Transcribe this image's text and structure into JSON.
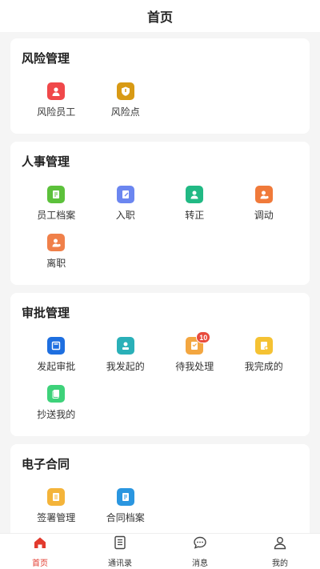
{
  "header": {
    "title": "首页"
  },
  "colors": {
    "accent": "#e23a2e",
    "badge": "#e84a3c"
  },
  "sections": [
    {
      "title": "风险管理",
      "items": [
        {
          "label": "风险员工",
          "icon": "risk-employee-icon",
          "color": "#f0484a"
        },
        {
          "label": "风险点",
          "icon": "risk-point-icon",
          "color": "#d89a14"
        }
      ]
    },
    {
      "title": "人事管理",
      "items": [
        {
          "label": "员工档案",
          "icon": "employee-file-icon",
          "color": "#5cc13b"
        },
        {
          "label": "入职",
          "icon": "onboarding-icon",
          "color": "#6b86f0"
        },
        {
          "label": "转正",
          "icon": "regularization-icon",
          "color": "#21b984"
        },
        {
          "label": "调动",
          "icon": "transfer-icon",
          "color": "#f07a3a"
        },
        {
          "label": "离职",
          "icon": "resignation-icon",
          "color": "#f0804a"
        }
      ]
    },
    {
      "title": "审批管理",
      "items": [
        {
          "label": "发起审批",
          "icon": "start-approval-icon",
          "color": "#1e6fe0"
        },
        {
          "label": "我发起的",
          "icon": "my-initiated-icon",
          "color": "#2ab0b8"
        },
        {
          "label": "待我处理",
          "icon": "pending-icon",
          "color": "#f3a640",
          "badge": "10"
        },
        {
          "label": "我完成的",
          "icon": "completed-icon",
          "color": "#f5c233"
        },
        {
          "label": "抄送我的",
          "icon": "cc-me-icon",
          "color": "#3ed27a"
        }
      ]
    },
    {
      "title": "电子合同",
      "items": [
        {
          "label": "签署管理",
          "icon": "sign-manage-icon",
          "color": "#f4b43a"
        },
        {
          "label": "合同档案",
          "icon": "contract-file-icon",
          "color": "#2a96e0"
        }
      ]
    }
  ],
  "tabbar": [
    {
      "label": "首页",
      "icon": "home-icon",
      "active": true
    },
    {
      "label": "通讯录",
      "icon": "contacts-icon",
      "active": false
    },
    {
      "label": "消息",
      "icon": "message-icon",
      "active": false
    },
    {
      "label": "我的",
      "icon": "profile-icon",
      "active": false
    }
  ]
}
